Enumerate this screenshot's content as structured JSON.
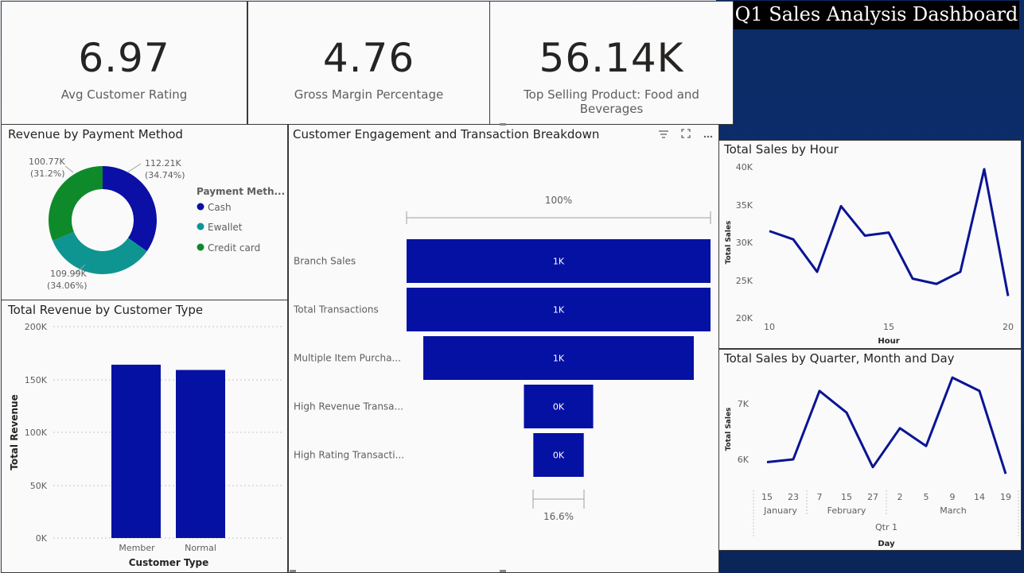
{
  "dashboard_title": "Q1 Sales Analysis Dashboard",
  "kpis": [
    {
      "value": "6.97",
      "label": "Avg Customer Rating"
    },
    {
      "value": "4.76",
      "label": "Gross Margin Percentage"
    },
    {
      "value": "56.14K",
      "label": "Top Selling Product: Food and Beverages"
    }
  ],
  "colors": {
    "navy": "#0b0fa5",
    "teal": "#0e9592",
    "green": "#0f8a2a",
    "bar": "#0511a3",
    "line": "#0a1494"
  },
  "icons": [
    "filter-icon",
    "focus-mode-icon",
    "more-options-icon"
  ],
  "charts": {
    "payment": {
      "title": "Revenue by Payment Method",
      "legend_title": "Payment Meth...",
      "labels": [
        {
          "value": "112.21K",
          "pct": "(34.74%)"
        },
        {
          "value": "109.99K",
          "pct": "(34.06%)"
        },
        {
          "value": "100.77K",
          "pct": "(31.2%)"
        }
      ]
    },
    "customer_type": {
      "title": "Total Revenue by Customer Type",
      "ylabel": "Total Revenue",
      "xlabel": "Customer Type",
      "yticks": [
        "200K",
        "150K",
        "100K",
        "50K",
        "0K"
      ]
    },
    "funnel": {
      "title": "Customer Engagement and Transaction Breakdown",
      "top_pct": "100%",
      "bottom_pct": "16.6%"
    },
    "hour": {
      "title": "Total Sales by Hour",
      "ylabel": "Total Sales",
      "xlabel": "Hour",
      "yticks": [
        "40K",
        "35K",
        "30K",
        "25K",
        "20K"
      ],
      "xticks": [
        "10",
        "15",
        "20"
      ]
    },
    "day": {
      "title": "Total Sales by Quarter, Month and Day",
      "ylabel": "Total Sales",
      "xlabel": "Day",
      "yticks": [
        "7K",
        "6K"
      ],
      "day_ticks": [
        "15",
        "23",
        "7",
        "15",
        "27",
        "2",
        "5",
        "9",
        "14",
        "19"
      ],
      "months": [
        "January",
        "February",
        "March"
      ],
      "quarter": "Qtr 1"
    }
  },
  "chart_data": [
    {
      "type": "pie",
      "title": "Revenue by Payment Method",
      "legend": "Payment Meth...",
      "categories": [
        "Cash",
        "Ewallet",
        "Credit card"
      ],
      "values": [
        112210,
        109990,
        100770
      ],
      "percents": [
        34.74,
        34.06,
        31.2
      ]
    },
    {
      "type": "bar",
      "title": "Total Revenue by Customer Type",
      "xlabel": "Customer Type",
      "ylabel": "Total Revenue",
      "categories": [
        "Member",
        "Normal"
      ],
      "values": [
        164000,
        159000
      ],
      "ylim": [
        0,
        200000
      ],
      "grid": true
    },
    {
      "type": "bar",
      "title": "Customer Engagement and Transaction Breakdown",
      "categories": [
        "Branch Sales",
        "Total Transactions",
        "Multiple Item Purcha...",
        "High Revenue Transa...",
        "High Rating Transacti..."
      ],
      "labels": [
        "1K",
        "1K",
        "1K",
        "0K",
        "0K"
      ],
      "values": [
        1000,
        1000,
        890,
        228,
        166
      ]
    },
    {
      "type": "line",
      "title": "Total Sales by Hour",
      "xlabel": "Hour",
      "ylabel": "Total Sales",
      "x": [
        10,
        11,
        12,
        13,
        14,
        15,
        16,
        17,
        18,
        19,
        20
      ],
      "y": [
        31500,
        30400,
        26100,
        34800,
        30900,
        31300,
        25200,
        24500,
        26100,
        39700,
        22900
      ],
      "xlim": [
        10,
        20
      ],
      "ylim": [
        20000,
        40000
      ]
    },
    {
      "type": "line",
      "title": "Total Sales by Quarter, Month and Day",
      "xlabel": "Day",
      "ylabel": "Total Sales",
      "x": [
        "2019-01-15",
        "2019-01-23",
        "2019-02-07",
        "2019-02-15",
        "2019-02-27",
        "2019-03-02",
        "2019-03-05",
        "2019-03-09",
        "2019-03-14",
        "2019-03-19"
      ],
      "y": [
        5950,
        6000,
        7230,
        6840,
        5860,
        6560,
        6240,
        7470,
        7230,
        5740
      ],
      "ylim": [
        5600,
        7600
      ]
    }
  ]
}
